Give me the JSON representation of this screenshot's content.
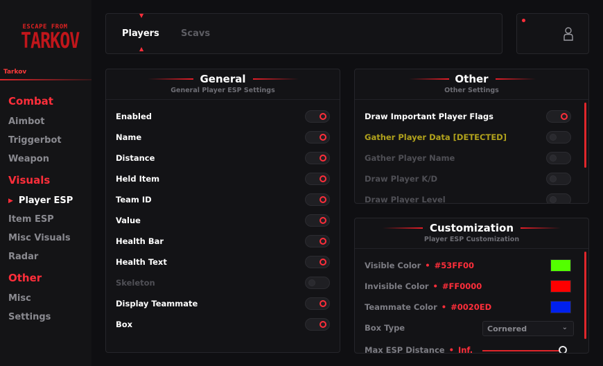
{
  "sidebar": {
    "logo_line1": "ESCAPE FROM",
    "logo_line2": "TARKOV",
    "brand": "Tarkov",
    "sections": [
      {
        "label": "Combat",
        "items": [
          "Aimbot",
          "Triggerbot",
          "Weapon"
        ]
      },
      {
        "label": "Visuals",
        "items": [
          "Player ESP",
          "Item ESP",
          "Misc Visuals",
          "Radar"
        ]
      },
      {
        "label": "Other",
        "items": [
          "Misc",
          "Settings"
        ]
      }
    ],
    "active_item": "Player ESP",
    "active_marker": "▶"
  },
  "tabs": {
    "active": "Players",
    "inactive": "Scavs"
  },
  "general": {
    "title": "General",
    "subtitle": "General Player ESP Settings",
    "rows": [
      {
        "label": "Enabled",
        "state": "on"
      },
      {
        "label": "Name",
        "state": "on"
      },
      {
        "label": "Distance",
        "state": "on"
      },
      {
        "label": "Held Item",
        "state": "on"
      },
      {
        "label": "Team ID",
        "state": "on"
      },
      {
        "label": "Value",
        "state": "on"
      },
      {
        "label": "Health Bar",
        "state": "on"
      },
      {
        "label": "Health Text",
        "state": "on"
      },
      {
        "label": "Skeleton",
        "state": "off"
      },
      {
        "label": "Display Teammate",
        "state": "on"
      },
      {
        "label": "Box",
        "state": "on"
      }
    ]
  },
  "other": {
    "title": "Other",
    "subtitle": "Other Settings",
    "rows": [
      {
        "label": "Draw Important Player Flags",
        "state": "on"
      },
      {
        "label": "Gather Player Data [DETECTED]",
        "state": "off"
      },
      {
        "label": "Gather Player Name",
        "state": "off"
      },
      {
        "label": "Draw Player K/D",
        "state": "off"
      },
      {
        "label": "Draw Player Level",
        "state": "off"
      }
    ]
  },
  "customization": {
    "title": "Customization",
    "subtitle": "Player ESP Customization",
    "visible_label": "Visible Color",
    "visible_hex": "#53FF00",
    "invisible_label": "Invisible Color",
    "invisible_hex": "#FF0000",
    "teammate_label": "Teammate Color",
    "teammate_hex": "#0020ED",
    "box_type_label": "Box Type",
    "box_type_value": "Cornered",
    "max_distance_label": "Max ESP Distance",
    "max_distance_value": "Inf.",
    "max_distance_fraction": 1.0
  },
  "colors": {
    "accent": "#ff2e3a",
    "visible": "#53FF00",
    "invisible": "#FF0000",
    "teammate": "#0020ED"
  },
  "icons": {
    "user": "user-icon",
    "chevron": "chevron-down-icon"
  }
}
